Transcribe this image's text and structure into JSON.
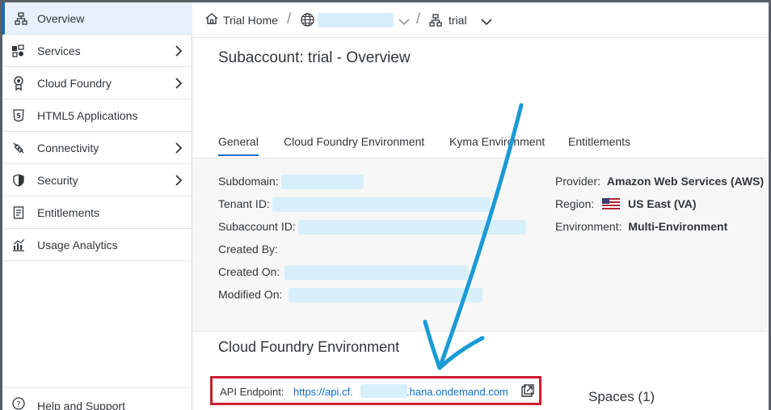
{
  "sidebar": {
    "items": [
      {
        "label": "Overview",
        "icon": "hierarchy-icon",
        "chevron": false,
        "selected": true
      },
      {
        "label": "Services",
        "icon": "services-icon",
        "chevron": true
      },
      {
        "label": "Cloud Foundry",
        "icon": "cloud-foundry-icon",
        "chevron": true
      },
      {
        "label": "HTML5 Applications",
        "icon": "html5-icon",
        "chevron": false
      },
      {
        "label": "Connectivity",
        "icon": "connectivity-icon",
        "chevron": true
      },
      {
        "label": "Security",
        "icon": "shield-icon",
        "chevron": true
      },
      {
        "label": "Entitlements",
        "icon": "entitlements-icon",
        "chevron": false
      },
      {
        "label": "Usage Analytics",
        "icon": "analytics-icon",
        "chevron": false
      }
    ],
    "footer_label": "Help and Support"
  },
  "header": {
    "home_label": "Trial Home",
    "separator": "/",
    "subaccount_label": "trial"
  },
  "main": {
    "title": "Subaccount: trial - Overview",
    "tabs": [
      {
        "label": "General",
        "active": true
      },
      {
        "label": "Cloud Foundry Environment"
      },
      {
        "label": "Kyma Environment"
      },
      {
        "label": "Entitlements"
      }
    ],
    "general": {
      "subdomain_label": "Subdomain:",
      "tenant_label": "Tenant ID:",
      "subaccount_id_label": "Subaccount ID:",
      "created_by_label": "Created By:",
      "created_on_label": "Created On:",
      "modified_on_label": "Modified On:",
      "provider_label": "Provider:",
      "provider_value": "Amazon Web Services (AWS)",
      "region_label": "Region:",
      "region_value": "US East (VA)",
      "environment_label": "Environment:",
      "environment_value": "Multi-Environment"
    },
    "cf_section_title": "Cloud Foundry Environment",
    "api_endpoint": {
      "label": "API Endpoint:",
      "link_prefix": "https://api.cf.",
      "link_suffix": ".hana.ondemand.com"
    },
    "spaces_label": "Spaces (1)"
  },
  "colors": {
    "accent": "#0a6ed1",
    "highlight_box": "#cc1f2f",
    "annotation_arrow": "#1a9ad6",
    "redaction": "#d7effa"
  }
}
